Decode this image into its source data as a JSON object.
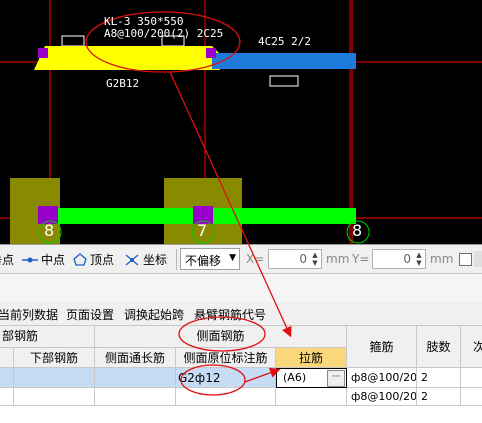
{
  "cad": {
    "beam_label_line1": "KL-3 350*550",
    "beam_label_line2": "A8@100/200(2) 2C25",
    "top_rebar_label": "4C25 2/2",
    "bottom_rebar_label": "G2B12",
    "axis_labels": [
      "8",
      "7",
      "8"
    ],
    "colors": {
      "beam_yellow": "#ffff00",
      "beam_blue": "#1e7bdc",
      "beam_green": "#00ff00",
      "column_olive": "#8a8a00",
      "node_purple": "#9900cc",
      "grid_red": "#ff0000",
      "annotation_red": "#e01010"
    }
  },
  "snap_toolbar": {
    "item0": "垂点",
    "midpoint": "中点",
    "vertex": "顶点",
    "coordinate": "坐标",
    "offset_mode": "不偏移",
    "x_label": "X=",
    "x_value": "0",
    "x_unit": "mm",
    "y_label": "Y=",
    "y_value": "0",
    "y_unit": "mm"
  },
  "menu": {
    "copy_current_column": "当前列数据",
    "page_setup": "页面设置",
    "switch_start_span": "调换起始跨",
    "cantilever_code": "悬臂钢筋代号"
  },
  "table": {
    "group_headers": {
      "bottom": "部钢筋",
      "side": "侧面钢筋"
    },
    "headers": {
      "bottom_rebar": "下部钢筋",
      "side_through": "侧面通长筋",
      "side_original": "侧面原位标注筋",
      "tie_rebar": "拉筋",
      "stirrup": "箍筋",
      "legs": "肢数",
      "next": "次"
    },
    "rows": [
      {
        "side_original": "G2ф12",
        "tie_rebar": "(A6)",
        "stirrup": "ф8@100/20",
        "legs": "2"
      },
      {
        "side_original": "",
        "tie_rebar": "",
        "stirrup": "ф8@100/20",
        "legs": "2"
      }
    ],
    "ellipsis": "···"
  }
}
